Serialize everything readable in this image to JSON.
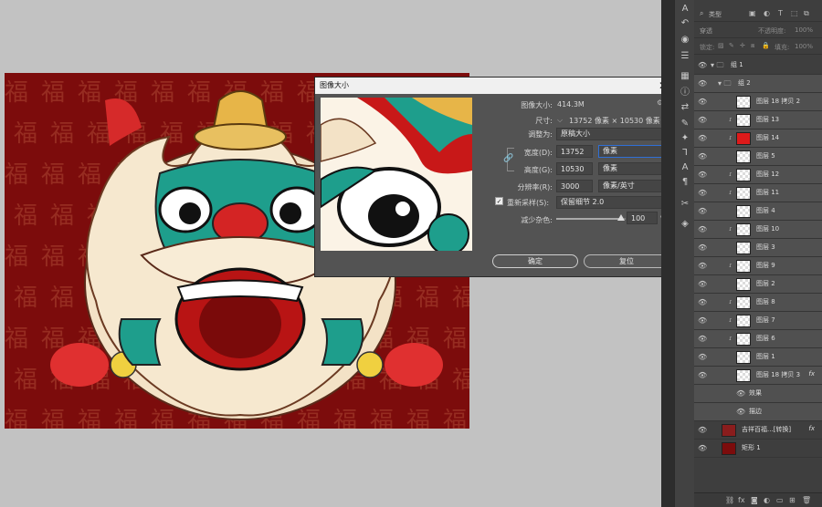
{
  "dialog": {
    "title": "图像大小",
    "close": "✕",
    "image_size_label": "图像大小:",
    "image_size_value": "414.3M",
    "dimensions_label": "尺寸:",
    "dimensions_value": "13752 像素 × 10530 像素",
    "fit_label": "调整为:",
    "fit_value": "原稿大小",
    "width_label": "宽度(D):",
    "width_value": "13752",
    "width_unit": "像素",
    "height_label": "高度(G):",
    "height_value": "10530",
    "height_unit": "像素",
    "resolution_label": "分辨率(R):",
    "resolution_value": "3000",
    "resolution_unit": "像素/英寸",
    "resample_label": "重新采样(S):",
    "resample_value": "保留细节 2.0",
    "noise_label": "减少杂色:",
    "noise_value": "100",
    "noise_unit": "%",
    "noise_level": 1.0,
    "ok_label": "确定",
    "reset_label": "复位"
  },
  "layers_panel": {
    "kind_label": "类型",
    "blend_mode": "穿透",
    "opacity_label": "不透明度:",
    "opacity_value": "100%",
    "lock_label": "锁定:",
    "fill_label": "填充:",
    "fill_value": "100%",
    "layers": [
      {
        "name": "组 1",
        "type": "group"
      },
      {
        "name": "组 2",
        "type": "group"
      },
      {
        "name": "图层 18 拷贝 2",
        "type": "layer"
      },
      {
        "name": "图层 13",
        "type": "layer"
      },
      {
        "name": "图层 14",
        "type": "layer"
      },
      {
        "name": "图层 5",
        "type": "layer"
      },
      {
        "name": "图层 12",
        "type": "layer"
      },
      {
        "name": "图层 11",
        "type": "layer"
      },
      {
        "name": "图层 4",
        "type": "layer"
      },
      {
        "name": "图层 10",
        "type": "layer"
      },
      {
        "name": "图层 3",
        "type": "layer"
      },
      {
        "name": "图层 9",
        "type": "layer"
      },
      {
        "name": "图层 2",
        "type": "layer"
      },
      {
        "name": "图层 8",
        "type": "layer"
      },
      {
        "name": "图层 7",
        "type": "layer"
      },
      {
        "name": "图层 6",
        "type": "layer"
      },
      {
        "name": "图层 1",
        "type": "layer"
      },
      {
        "name": "图层 18 拷贝 3",
        "type": "layer"
      },
      {
        "name": "效果",
        "type": "effect"
      },
      {
        "name": "描边",
        "type": "effect"
      },
      {
        "name": "吉祥百福...[转换]",
        "type": "layer"
      },
      {
        "name": "矩形 1",
        "type": "layer"
      }
    ],
    "fx_label": "fx"
  },
  "canvas": {
    "background_char": "福",
    "background_color": "#7c0c0c"
  }
}
